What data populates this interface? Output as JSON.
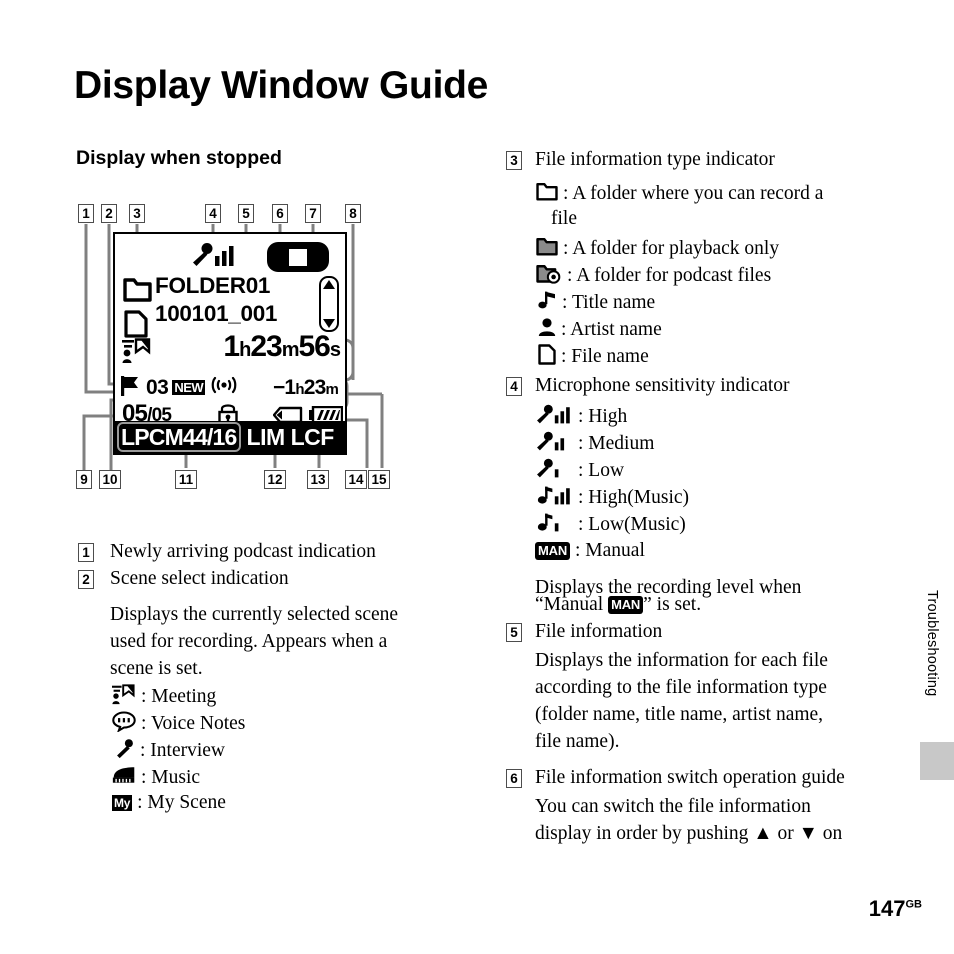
{
  "page": {
    "title": "Display Window Guide",
    "section_heading": "Display when stopped",
    "page_number": "147",
    "page_number_suffix": "GB",
    "side_tab": "Troubleshooting"
  },
  "diagram": {
    "callouts_top": [
      "1",
      "2",
      "3",
      "4",
      "5",
      "6",
      "7",
      "8"
    ],
    "callouts_bottom": [
      "9",
      "10",
      "11",
      "12",
      "13",
      "14",
      "15"
    ],
    "lcd": {
      "mic_sensitivity_icon": "mic-high-icon",
      "stop_icon": "stop-icon",
      "folder_icon": "folder-recordable-icon",
      "file_icon": "file-name-icon",
      "folder_name": "FOLDER01",
      "file_name": "100101_001",
      "scroll_icon": "scroll-updown-icon",
      "scene_icon": "scene-meeting-icon",
      "elapsed_hours": "1",
      "elapsed_hours_unit": "h",
      "elapsed_minutes": "23",
      "elapsed_minutes_unit": "m",
      "elapsed_seconds": "56",
      "elapsed_seconds_unit": "s",
      "flag_icon": "track-mark-flag-icon",
      "flag_count": "03",
      "new_badge": "NEW",
      "alarm_icon": "alarm-icon",
      "remain_sign": "−1",
      "remain_hours_unit": "h",
      "remain_minutes": "23",
      "remain_minutes_unit": "m",
      "index_current": "05",
      "index_sep": "/",
      "index_total": "05",
      "lock_icon": "lock-icon",
      "repeat_icon": "repeat-icon",
      "battery_icon": "battery-icon",
      "codec": "LPCM44/16",
      "limiter": "LIM",
      "lowcut": "LCF"
    }
  },
  "left_column": {
    "items": [
      {
        "num": "1",
        "heading": "Newly arriving podcast indication",
        "body": [],
        "icons": []
      },
      {
        "num": "2",
        "heading": "Scene select indication",
        "body": [
          "Displays the currently selected scene",
          "used for recording. Appears when a",
          "scene is set."
        ],
        "icons": [
          {
            "icon": "scene-meeting-icon",
            "label": ": Meeting"
          },
          {
            "icon": "scene-voice-notes-icon",
            "label": ": Voice Notes"
          },
          {
            "icon": "scene-interview-icon",
            "label": ": Interview"
          },
          {
            "icon": "scene-music-icon",
            "label": ": Music"
          },
          {
            "icon": "scene-my-scene-icon",
            "label": ": My Scene",
            "badge": "My"
          }
        ]
      }
    ]
  },
  "right_column": {
    "items": [
      {
        "num": "3",
        "heading": "File information type indicator",
        "icons": [
          {
            "icon": "folder-recordable-icon",
            "label": ": A folder where you can record a"
          },
          {
            "icon": "",
            "label": "file",
            "continuation": true
          },
          {
            "icon": "folder-playback-icon",
            "label": ": A folder for playback only"
          },
          {
            "icon": "folder-podcast-icon",
            "label": ": A folder for podcast files"
          },
          {
            "icon": "music-note-icon",
            "label": ": Title name"
          },
          {
            "icon": "artist-person-icon",
            "label": ": Artist name"
          },
          {
            "icon": "file-page-icon",
            "label": ": File name"
          }
        ]
      },
      {
        "num": "4",
        "heading": "Microphone sensitivity indicator",
        "icons": [
          {
            "icon": "mic-high-icon",
            "label": ": High"
          },
          {
            "icon": "mic-medium-icon",
            "label": ": Medium"
          },
          {
            "icon": "mic-low-icon",
            "label": ": Low"
          },
          {
            "icon": "music-high-icon",
            "label": ": High(Music)"
          },
          {
            "icon": "music-low-icon",
            "label": ": Low(Music)"
          },
          {
            "icon": "man-badge-icon",
            "label": ": Manual",
            "badge": "MAN"
          }
        ],
        "body_before": "Displays the recording level when",
        "body_quote_pre": "“Manual ",
        "body_quote_badge": "MAN",
        "body_quote_post": "” is set."
      },
      {
        "num": "5",
        "heading": "File information",
        "body": [
          "Displays the information for each file",
          "according to the file information type",
          "(folder name, title name, artist name,",
          "file name)."
        ]
      },
      {
        "num": "6",
        "heading": "File information switch operation guide",
        "body": [
          "You can switch the file information",
          "display in order by pushing ▲ or ▼ on"
        ]
      }
    ]
  }
}
